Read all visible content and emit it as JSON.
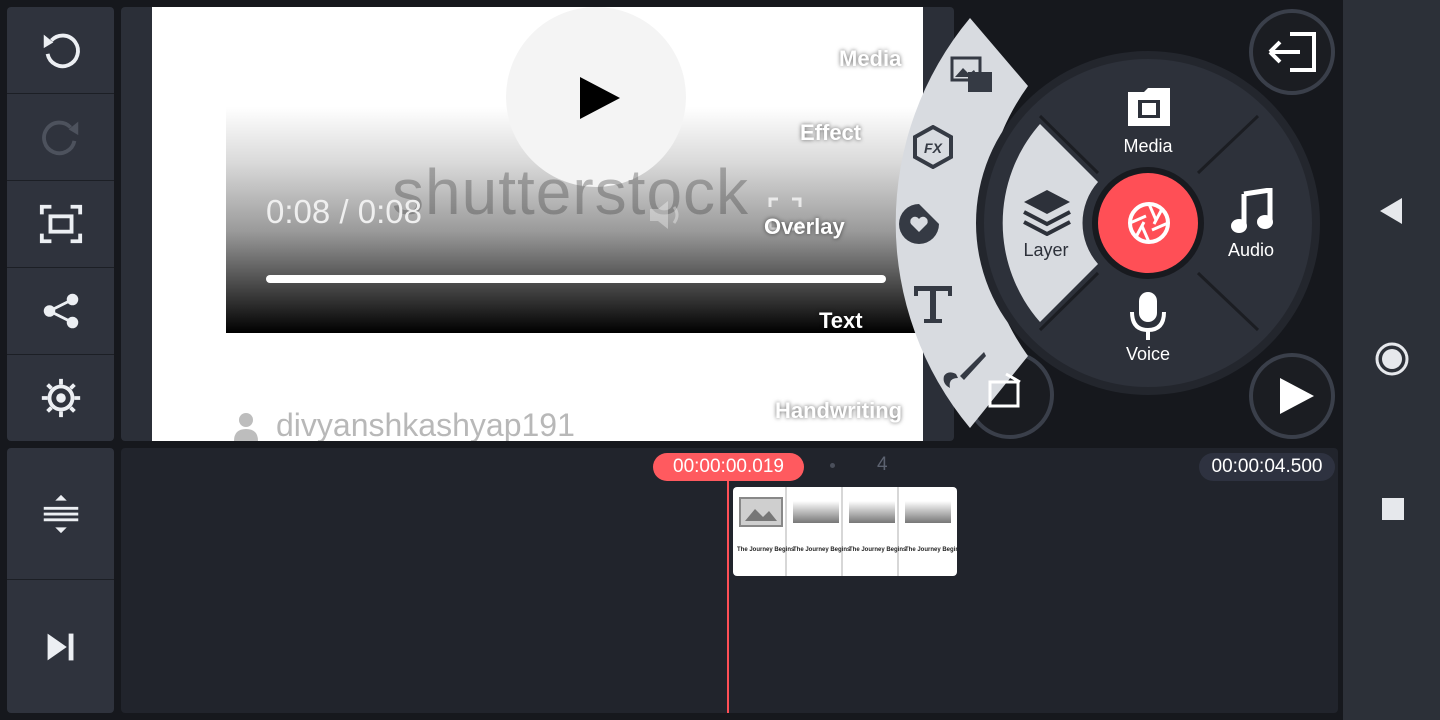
{
  "preview": {
    "time_readout": "0:08 / 0:08",
    "watermark": "shutterstock",
    "author": "divyanshkashyap191",
    "menu_labels": {
      "media": "Media",
      "effect": "Effect",
      "overlay": "Overlay",
      "text": "Text",
      "handwriting": "Handwriting"
    }
  },
  "radial": {
    "media": "Media",
    "layer": "Layer",
    "audio": "Audio",
    "voice": "Voice"
  },
  "timeline": {
    "current_time": "00:00:00.019",
    "end_time": "00:00:04.500",
    "marker": "4",
    "clip_caption": "The Journey Begins"
  },
  "colors": {
    "accent": "#ff5a5f",
    "panel": "#2f333d",
    "timeline": "#21242c"
  }
}
